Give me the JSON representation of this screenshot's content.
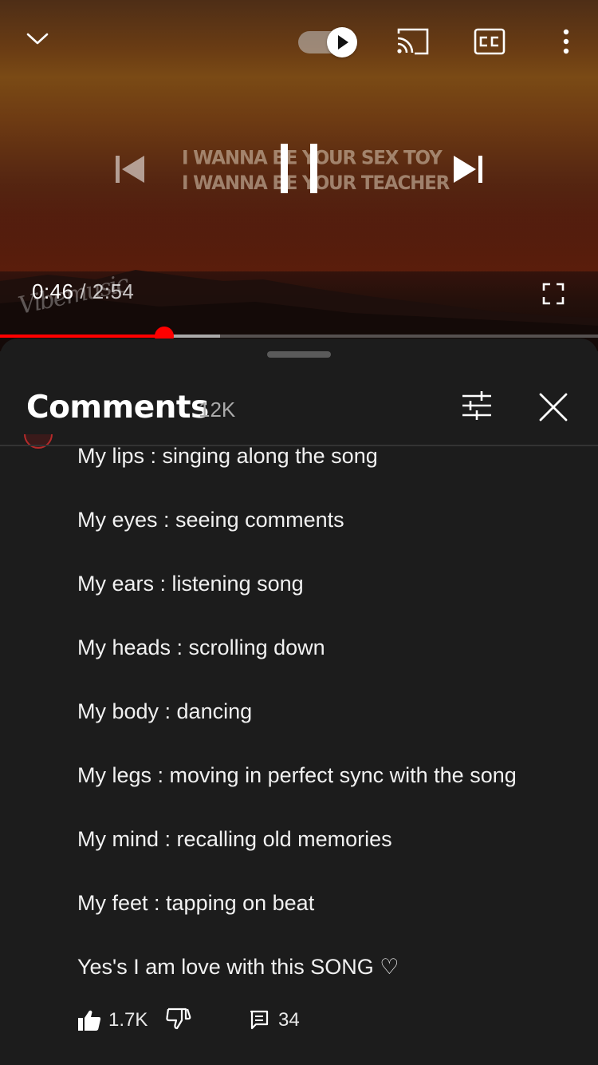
{
  "player": {
    "lyrics": [
      "I WANNA BE YOUR SEX TOY",
      "I WANNA BE YOUR TEACHER"
    ],
    "current_time": "0:46",
    "duration": "2:54",
    "separator": " / ",
    "watermark": "Vibemusic",
    "progress_played": 0.275,
    "progress_buffered": 0.368,
    "autoplay_on": true,
    "icons": {
      "minimize": "chevron-down-icon",
      "autoplay": "autoplay-toggle",
      "cast": "cast-icon",
      "captions": "cc-icon",
      "more": "more-vertical-icon",
      "previous": "skip-previous-icon",
      "pause": "pause-icon",
      "next": "skip-next-icon",
      "fullscreen": "fullscreen-icon"
    }
  },
  "comments_panel": {
    "title": "Comments",
    "count": "12K",
    "icons": {
      "filter": "sliders-icon",
      "close": "close-icon"
    },
    "comment": {
      "lines": [
        "My lips : singing along the song",
        "My eyes : seeing comments",
        "My ears : listening song",
        "My heads : scrolling down",
        "My body : dancing",
        "My legs : moving in perfect sync with the song",
        "My mind : recalling old memories",
        "My feet : tapping on beat",
        "Yes's I am love with this SONG ♡"
      ],
      "likes": "1.7K",
      "replies": "34"
    }
  },
  "colors": {
    "accent_red": "#ff0000",
    "sheet_bg": "#1c1c1c",
    "text_secondary": "#aaaaaa"
  }
}
